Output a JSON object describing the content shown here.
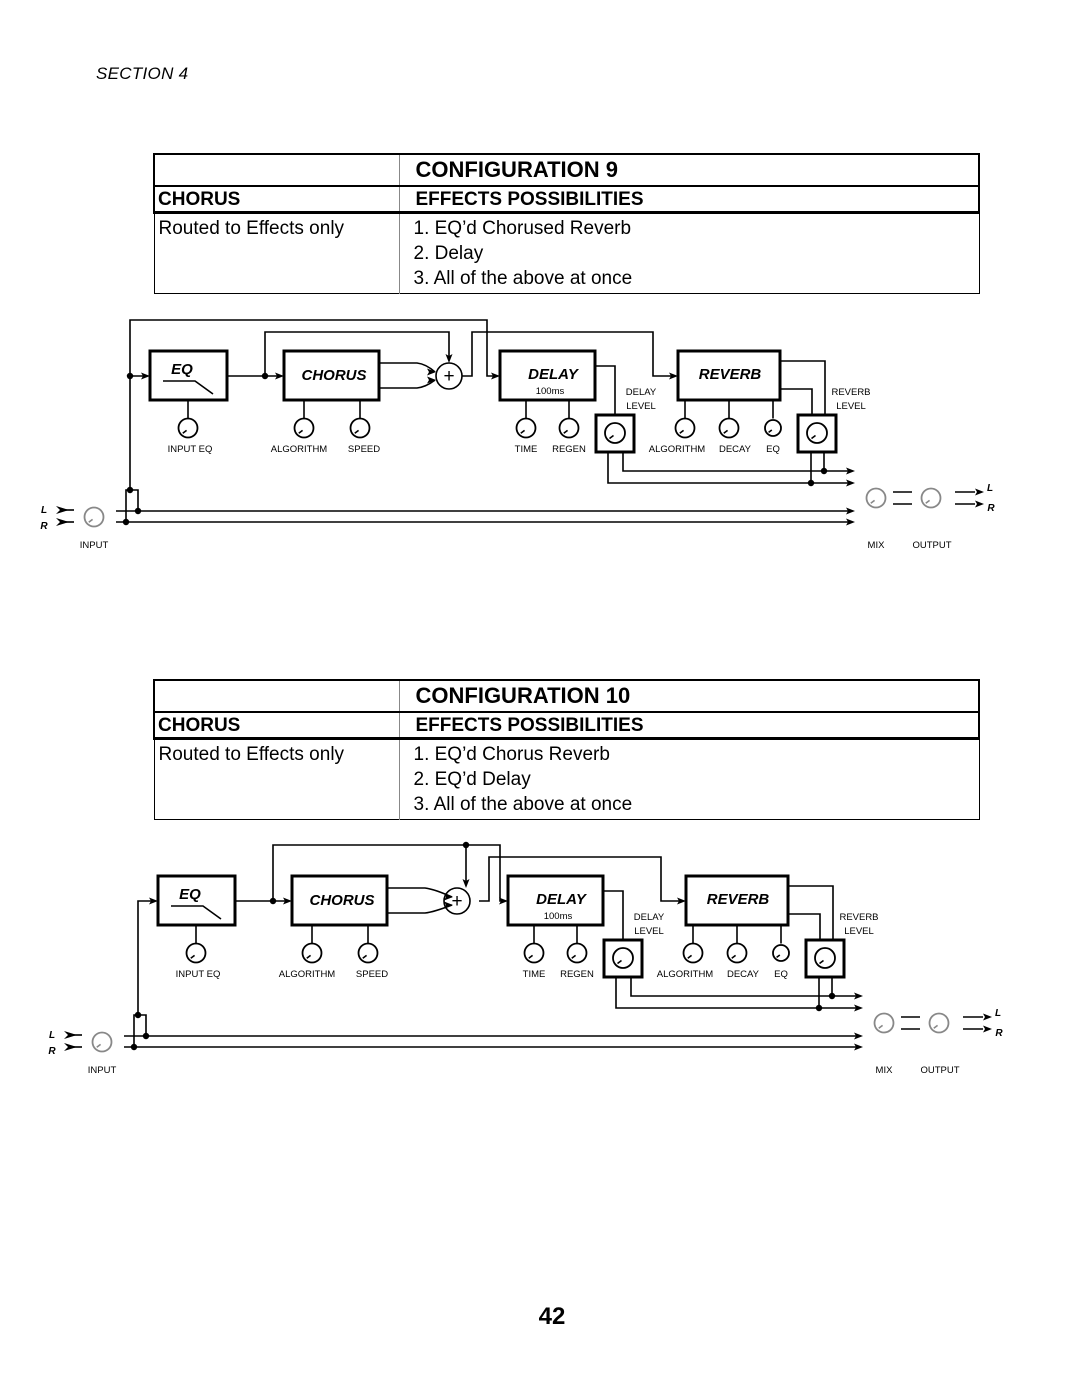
{
  "header": {
    "section_label": "SECTION  4"
  },
  "configurations": [
    {
      "title": "CONFIGURATION 9",
      "left_header": "CHORUS",
      "right_header": "EFFECTS POSSIBILITIES",
      "routing": "Routed to Effects only",
      "possibilities": [
        "1. EQ’d Chorused Reverb",
        "2. Delay",
        "3. All of the above at once"
      ],
      "diagram": {
        "blocks": {
          "eq": "EQ",
          "chorus": "CHORUS",
          "delay": "DELAY",
          "delay_time": "100ms",
          "reverb": "REVERB"
        },
        "knobs": {
          "input_eq": "INPUT EQ",
          "algorithm": "ALGORITHM",
          "speed": "SPEED",
          "time": "TIME",
          "regen": "REGEN",
          "rev_algorithm": "ALGORITHM",
          "decay": "DECAY",
          "eq": "EQ"
        },
        "levels": {
          "delay_level": [
            "DELAY",
            "LEVEL"
          ],
          "reverb_level": [
            "REVERB",
            "LEVEL"
          ]
        },
        "io": {
          "left": "L",
          "right": "R",
          "input": "INPUT",
          "mix": "MIX",
          "output": "OUTPUT"
        },
        "input_tap_to_eq": true
      }
    },
    {
      "title": "CONFIGURATION 10",
      "left_header": "CHORUS",
      "right_header": "EFFECTS POSSIBILITIES",
      "routing": "Routed to Effects only",
      "possibilities": [
        "1. EQ’d Chorus Reverb",
        "2. EQ’d Delay",
        "3. All of the above at once"
      ],
      "diagram": {
        "blocks": {
          "eq": "EQ",
          "chorus": "CHORUS",
          "delay": "DELAY",
          "delay_time": "100ms",
          "reverb": "REVERB"
        },
        "knobs": {
          "input_eq": "INPUT EQ",
          "algorithm": "ALGORITHM",
          "speed": "SPEED",
          "time": "TIME",
          "regen": "REGEN",
          "rev_algorithm": "ALGORITHM",
          "decay": "DECAY",
          "eq": "EQ"
        },
        "levels": {
          "delay_level": [
            "DELAY",
            "LEVEL"
          ],
          "reverb_level": [
            "REVERB",
            "LEVEL"
          ]
        },
        "io": {
          "left": "L",
          "right": "R",
          "input": "INPUT",
          "mix": "MIX",
          "output": "OUTPUT"
        },
        "input_tap_to_eq": false
      }
    }
  ],
  "footer": {
    "page_number": "42"
  }
}
